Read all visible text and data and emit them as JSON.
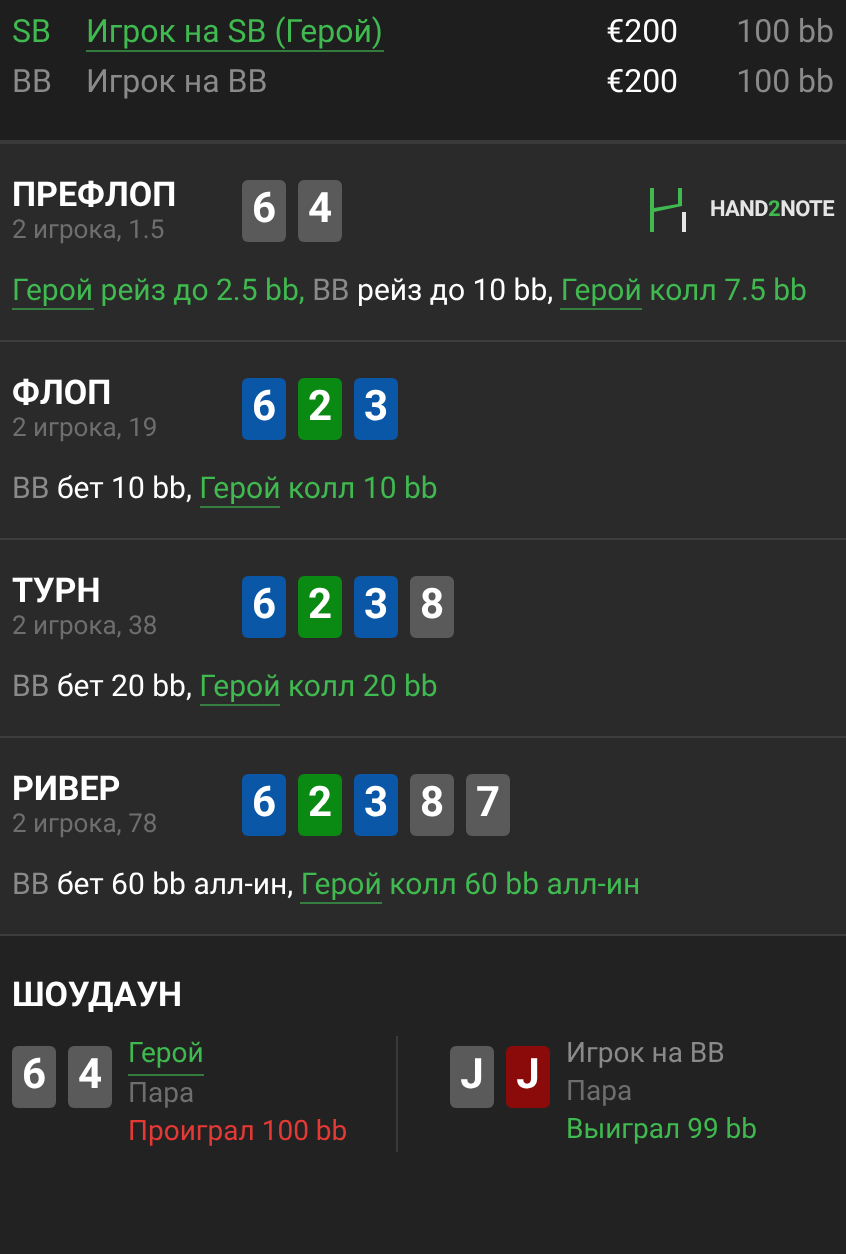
{
  "players": [
    {
      "position": "SB",
      "name": "Игрок на SB (Герой)",
      "hero": true,
      "stack": "€200",
      "stack_bb": "100 bb"
    },
    {
      "position": "BB",
      "name": "Игрок на BB",
      "hero": false,
      "stack": "€200",
      "stack_bb": "100 bb"
    }
  ],
  "logo": {
    "parts": [
      "HAND",
      "2",
      "NOTE"
    ]
  },
  "streets": [
    {
      "title": "ПРЕФЛОП",
      "info": "2 игрока, 1.5",
      "cards": [
        {
          "rank": "6",
          "color": "#5a5a5a"
        },
        {
          "rank": "4",
          "color": "#5a5a5a"
        }
      ],
      "actions": [
        {
          "text": "Герой",
          "kind": "hero"
        },
        {
          "text": "рейз до 2.5 bb,",
          "kind": "hero_action"
        },
        {
          "text": "BB",
          "kind": "villain"
        },
        {
          "text": "рейз до 10 bb,",
          "kind": "villain_action"
        },
        {
          "text": "Герой",
          "kind": "hero"
        },
        {
          "text": "колл 7.5 bb",
          "kind": "hero_action"
        }
      ]
    },
    {
      "title": "ФЛОП",
      "info": "2 игрока, 19",
      "cards": [
        {
          "rank": "6",
          "color": "#0a57a8"
        },
        {
          "rank": "2",
          "color": "#0a8a12"
        },
        {
          "rank": "3",
          "color": "#0a57a8"
        }
      ],
      "actions": [
        {
          "text": "BB",
          "kind": "villain"
        },
        {
          "text": "бет 10 bb,",
          "kind": "villain_action"
        },
        {
          "text": "Герой",
          "kind": "hero"
        },
        {
          "text": "колл 10 bb",
          "kind": "hero_action"
        }
      ]
    },
    {
      "title": "ТУРН",
      "info": "2 игрока, 38",
      "cards": [
        {
          "rank": "6",
          "color": "#0a57a8"
        },
        {
          "rank": "2",
          "color": "#0a8a12"
        },
        {
          "rank": "3",
          "color": "#0a57a8"
        },
        {
          "rank": "8",
          "color": "#5a5a5a"
        }
      ],
      "actions": [
        {
          "text": "BB",
          "kind": "villain"
        },
        {
          "text": "бет 20 bb,",
          "kind": "villain_action"
        },
        {
          "text": "Герой",
          "kind": "hero"
        },
        {
          "text": "колл 20 bb",
          "kind": "hero_action"
        }
      ]
    },
    {
      "title": "РИВЕР",
      "info": "2 игрока, 78",
      "cards": [
        {
          "rank": "6",
          "color": "#0a57a8"
        },
        {
          "rank": "2",
          "color": "#0a8a12"
        },
        {
          "rank": "3",
          "color": "#0a57a8"
        },
        {
          "rank": "8",
          "color": "#5a5a5a"
        },
        {
          "rank": "7",
          "color": "#5a5a5a"
        }
      ],
      "actions": [
        {
          "text": "BB",
          "kind": "villain"
        },
        {
          "text": "бет 60 bb алл-ин,",
          "kind": "villain_action"
        },
        {
          "text": "Герой",
          "kind": "hero"
        },
        {
          "text": "колл 60 bb алл-ин",
          "kind": "hero_action"
        }
      ]
    }
  ],
  "showdown": {
    "title": "ШОУДАУН",
    "hands": [
      {
        "cards": [
          {
            "rank": "6",
            "color": "#5a5a5a"
          },
          {
            "rank": "4",
            "color": "#5a5a5a"
          }
        ],
        "player": "Герой",
        "hero": true,
        "hand": "Пара",
        "result": "Проиграл 100 bb",
        "won": false
      },
      {
        "cards": [
          {
            "rank": "J",
            "color": "#5a5a5a"
          },
          {
            "rank": "J",
            "color": "#8b0a0a"
          }
        ],
        "player": "Игрок на BB",
        "hero": false,
        "hand": "Пара",
        "result": "Выиграл 99 bb",
        "won": true
      }
    ]
  }
}
